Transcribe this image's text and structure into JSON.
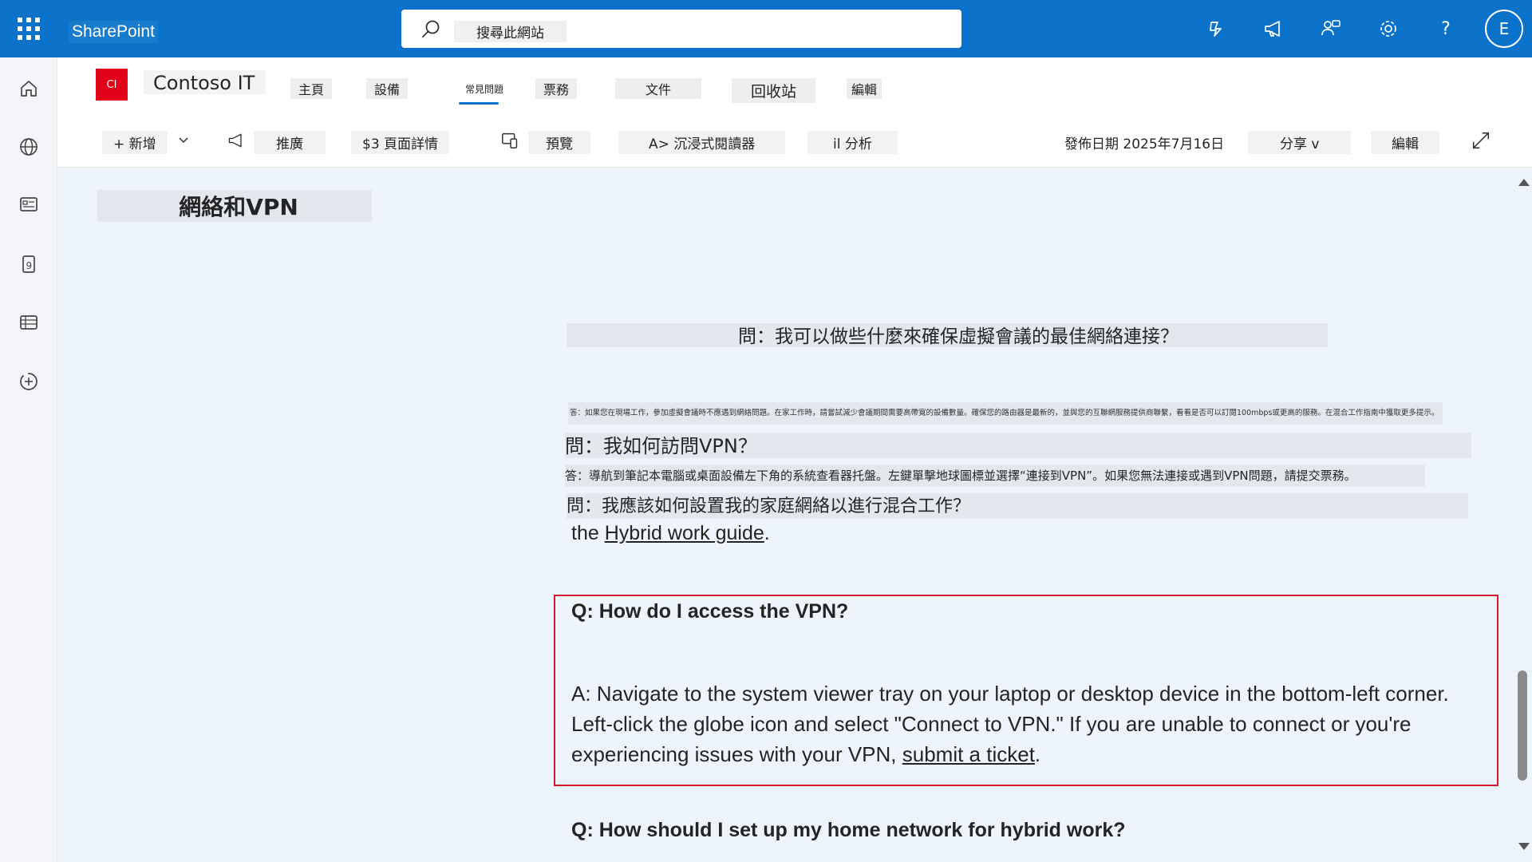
{
  "suitebar": {
    "brand": "SharePoint",
    "search_placeholder": "搜尋此網站",
    "avatar_initial": "E",
    "help_label": "?"
  },
  "site": {
    "logo_text": "CI",
    "name": "Contoso IT",
    "nav": [
      "主頁",
      "設備",
      "常見問題",
      "票務",
      "文件",
      "回收站",
      "編輯"
    ],
    "active_nav": "常見問題"
  },
  "commandbar": {
    "new_label": "+ 新增",
    "promote_label": "推廣",
    "page_details_label": "$3 頁面詳情",
    "preview_label": "預覽",
    "immersive_reader_label": "A> 沉浸式閱讀器",
    "analytics_label": "il 分析",
    "published": "發佈日期 2025年7月16日",
    "share_label": "分享 v",
    "edit_label": "編輯"
  },
  "content": {
    "section_title": "網絡和VPN",
    "q1": "問：我可以做些什麼來確保虛擬會議的最佳網絡連接？",
    "a1": "答：如果您在現場工作，參加虛擬會議時不應遇到網絡問題。在家工作時，請嘗試減少會議期間需要高帶寬的設備數量。確保您的路由器是最新的，並與您的互聯網服務提供商聯繫，看看是否可以訂閱100mbps或更高的服務。在混合工作指南中獲取更多提示。",
    "q2": "問：我如何訪問VPN？",
    "a2": "答：導航到筆記本電腦或桌面設備左下角的系統查看器托盤。左鍵單擊地球圖標並選擇“連接到VPN”。如果您無法連接或遇到VPN問題，請提交票務。",
    "q3": "問：我應該如何設置我的家庭網絡以進行混合工作？",
    "guide_prefix": "the ",
    "guide_link": "Hybrid work guide",
    "guide_suffix": ".",
    "en_q": "Q: How do I access the VPN?",
    "en_a": "A: Navigate to the system viewer tray on your laptop or desktop device in the bottom-left corner. Left-click the globe icon and select \"Connect to VPN.\" If you are unable to connect or you're experiencing issues with your VPN, ",
    "en_a_link": "submit a ticket",
    "en_a_suffix": ".",
    "en_q2": "Q: How should I set up my home network for hybrid work?"
  },
  "colors": {
    "suitebar": "#0a73c9",
    "highlight_border": "#d11a2a",
    "site_logo": "#e3001b"
  },
  "icons": {
    "suitebar": [
      "waffle-icon",
      "copilot-icon",
      "megaphone-icon",
      "people-chat-icon",
      "gear-icon",
      "help-icon"
    ],
    "appbar": [
      "home-icon",
      "globe-icon",
      "news-icon",
      "files-icon",
      "lists-icon",
      "create-icon"
    ]
  }
}
